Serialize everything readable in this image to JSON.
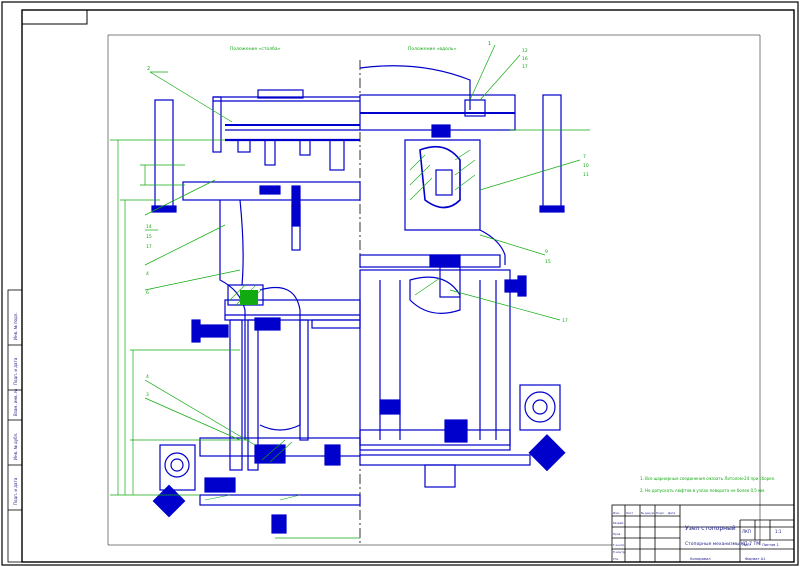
{
  "drawing": {
    "view_label_left": "Положение «столба»",
    "view_label_right": "Положение «вдоль»",
    "leaders": {
      "l1": "1",
      "l2": "2",
      "l3": "3",
      "l4": "4",
      "l5": "5",
      "l6": "6",
      "l7": "7",
      "l8": "8",
      "l9": "9",
      "l10": "10",
      "l11": "11",
      "l12": "12",
      "l13": "13",
      "l14": "14",
      "l15": "15",
      "l16": "16",
      "l17": "17"
    },
    "notes": [
      "1. Все шарнирные соединения смазать Литолом-24 при сборке.",
      "2. Не допускать люфтов в узлах поворота не более 0,5 мм."
    ],
    "colors": {
      "outline": "#0000cc",
      "annotation": "#11aa11",
      "frame": "#000000",
      "hatch": "#11aa11"
    }
  },
  "title_block": {
    "name": "Узел стопорный",
    "designation": "Стопорные механизмы КП-7 ТМ",
    "sheet_letter": "ЛКП",
    "mass": "1:1",
    "sheet": "Лист",
    "sheets": "Листов 1",
    "org": "Копировал",
    "format": "Формат А1",
    "roles": [
      "Изм.",
      "Лист",
      "№ докум.",
      "Подп.",
      "Дата",
      "Разраб.",
      "Пров.",
      "Т.контр.",
      "Н.контр.",
      "Утв."
    ]
  },
  "side_stamp": {
    "labels": [
      "Инв. № подл.",
      "Подп. и дата",
      "Взам. инв. №",
      "Инв. № дубл.",
      "Подп. и дата"
    ]
  }
}
